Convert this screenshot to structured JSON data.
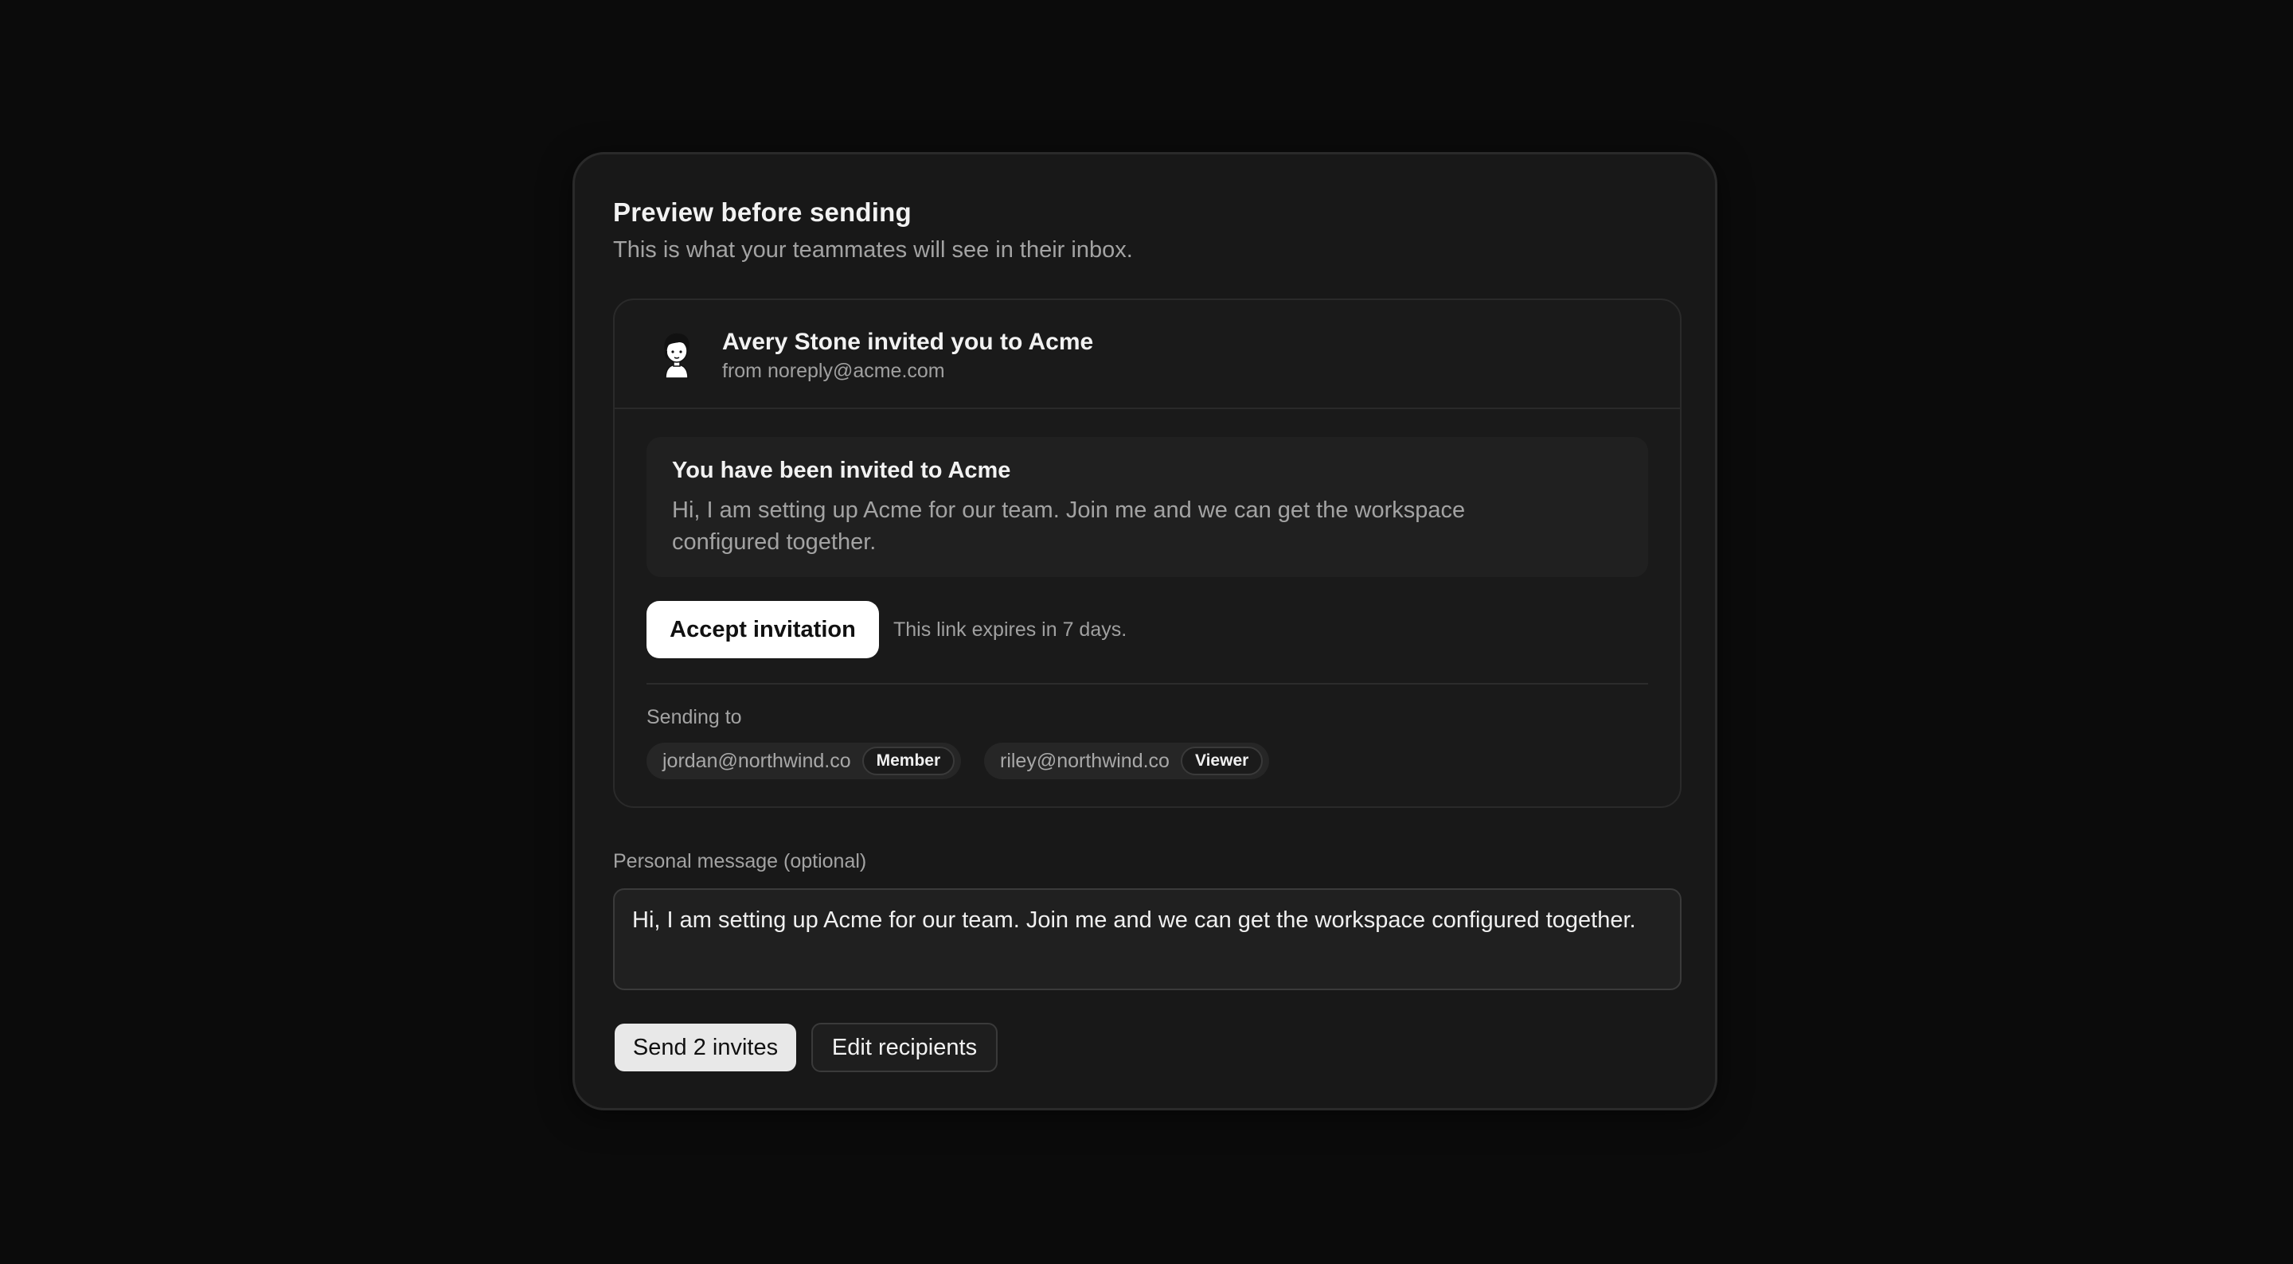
{
  "dialog": {
    "title": "Preview before sending",
    "subtitle": "This is what your teammates will see in their inbox."
  },
  "email_preview": {
    "avatar_icon": "person-avatar-icon",
    "sender_line": "Avery Stone invited you to Acme",
    "from_line": "from noreply@acme.com",
    "message_title": "You have been invited to Acme",
    "message_body": "Hi, I am setting up Acme for our team. Join me and we can get the workspace configured together.",
    "accept_label": "Accept invitation",
    "expires_note": "This link expires in 7 days.",
    "sending_to_label": "Sending to",
    "recipients": [
      {
        "email": "jordan@northwind.co",
        "role": "Member"
      },
      {
        "email": "riley@northwind.co",
        "role": "Viewer"
      }
    ]
  },
  "personal_message": {
    "label": "Personal message (optional)",
    "value": "Hi, I am setting up Acme for our team. Join me and we can get the workspace configured together."
  },
  "actions": {
    "send_label": "Send 2 invites",
    "edit_label": "Edit recipients"
  },
  "colors": {
    "background": "#0b0b0b",
    "card": "#181818",
    "primary_button": "#ffffff",
    "muted_text": "#a3a3a3"
  }
}
